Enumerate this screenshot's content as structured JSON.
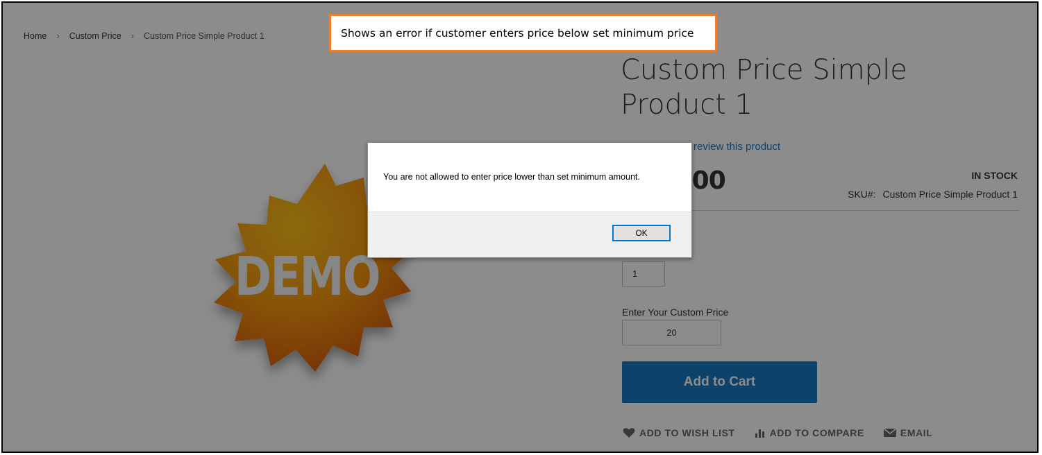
{
  "breadcrumb": {
    "items": [
      "Home",
      "Custom Price",
      "Custom Price Simple Product 1"
    ],
    "separator": ">"
  },
  "callout": {
    "text": "Shows an error if customer enters price below set minimum price",
    "border_color": "#ed7d31"
  },
  "product": {
    "image_text": "DEMO",
    "title": "Custom Price Simple Product 1",
    "review_link": "review this product",
    "price_visible": ".00",
    "stock_status": "IN STOCK",
    "sku_label": "SKU#:",
    "sku_value": "Custom Price Simple Product 1",
    "qty_value": "1",
    "custom_price_label": "Enter Your Custom Price",
    "custom_price_value": "20",
    "add_to_cart_label": "Add to Cart",
    "accent_color": "#1979c3"
  },
  "actions": {
    "wishlist": "ADD TO WISH LIST",
    "compare": "ADD TO COMPARE",
    "email": "EMAIL"
  },
  "dialog": {
    "message": "You are not allowed to enter price lower than set minimum amount.",
    "ok_label": "OK"
  },
  "icons": [
    "heart-icon",
    "bar-chart-icon",
    "envelope-icon",
    "chevron-right-icon"
  ]
}
